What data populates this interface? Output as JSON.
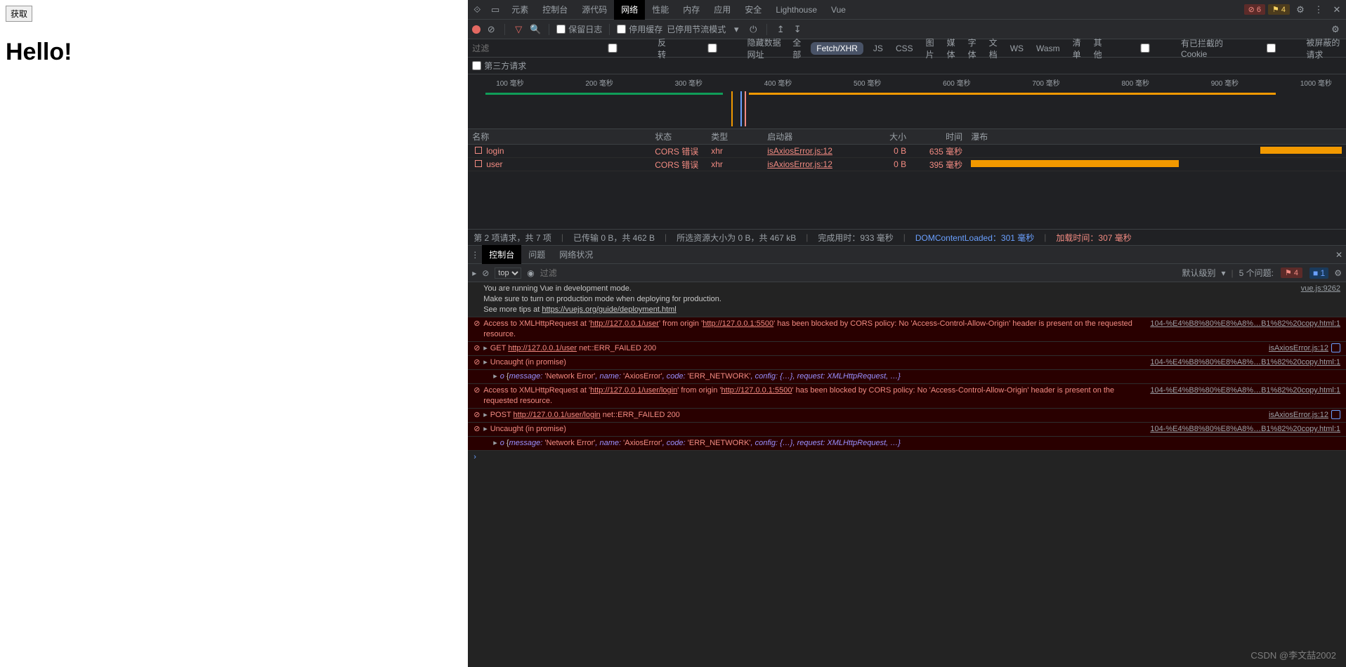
{
  "page": {
    "button": "获取",
    "heading": "Hello!"
  },
  "tabs": {
    "inspect": "",
    "device": "",
    "items": [
      "元素",
      "控制台",
      "源代码",
      "网络",
      "性能",
      "内存",
      "应用",
      "安全",
      "Lighthouse",
      "Vue"
    ],
    "active": "网络"
  },
  "topbadges": {
    "errors": "6",
    "warnings": "4"
  },
  "toolbar": {
    "preserve": "保留日志",
    "disablecache": "停用缓存",
    "throttling": "已停用节流模式"
  },
  "filter": {
    "placeholder": "过滤",
    "invert": "反转",
    "hidedata": "隐藏数据网址",
    "types": [
      "全部",
      "Fetch/XHR",
      "JS",
      "CSS",
      "图片",
      "媒体",
      "字体",
      "文档",
      "WS",
      "Wasm",
      "清单",
      "其他"
    ],
    "active": "Fetch/XHR",
    "blockedcookies": "有已拦截的 Cookie",
    "blockedreq": "被屏蔽的请求",
    "thirdparty": "第三方请求"
  },
  "timeline": {
    "ticks": [
      "100 毫秒",
      "200 毫秒",
      "300 毫秒",
      "400 毫秒",
      "500 毫秒",
      "600 毫秒",
      "700 毫秒",
      "800 毫秒",
      "900 毫秒",
      "1000 毫秒"
    ]
  },
  "net": {
    "headers": {
      "name": "名称",
      "status": "状态",
      "type": "类型",
      "initiator": "启动器",
      "size": "大小",
      "time": "时间",
      "waterfall": "瀑布"
    },
    "rows": [
      {
        "name": "login",
        "status": "CORS 错误",
        "type": "xhr",
        "initiator": "isAxiosError.js:12",
        "size": "0 B",
        "time": "635 毫秒",
        "wfStart": 78,
        "wfLen": 22
      },
      {
        "name": "user",
        "status": "CORS 错误",
        "type": "xhr",
        "initiator": "isAxiosError.js:12",
        "size": "0 B",
        "time": "395 毫秒",
        "wfStart": 0,
        "wfLen": 56
      }
    ],
    "summary": {
      "requests": "第 2 项请求，共 7 项",
      "transferred": "已传输 0 B，共 462 B",
      "resources": "所选资源大小为 0 B，共 467 kB",
      "finish": "完成用时：933 毫秒",
      "dcl": "DOMContentLoaded：301 毫秒",
      "load": "加载时间：307 毫秒"
    }
  },
  "drawer": {
    "tabs": [
      "控制台",
      "问题",
      "网络状况"
    ],
    "active": "控制台",
    "ctx": "top",
    "filterPh": "过滤",
    "level": "默认级别",
    "issues": "5 个问题:",
    "ierr": "4",
    "iwarn": "1"
  },
  "console": {
    "info1": "You are running Vue in development mode.\nMake sure to turn on production mode when deploying for production.\nSee more tips at ",
    "info1link": "https://vuejs.org/guide/deployment.html",
    "info1src": "vue.js:9262",
    "err1a": "Access to XMLHttpRequest at '",
    "err1url": "http://127.0.0.1/user",
    "err1b": "' from origin '",
    "err1orig": "http://127.0.0.1:5500",
    "err1c": "' has been blocked by CORS policy: No 'Access-Control-Allow-Origin' header is present on the requested resource.",
    "err1src": "104-%E4%B8%80%E8%A8%…B1%82%20copy.html:1",
    "err2a": "GET ",
    "err2url": "http://127.0.0.1/user",
    "err2b": " net::ERR_FAILED 200",
    "err2src": "isAxiosError.js:12",
    "err3": "Uncaught (in promise)",
    "err3src": "104-%E4%B8%80%E8%A8%…B1%82%20copy.html:1",
    "obj": "o {message: 'Network Error', name: 'AxiosError', code: 'ERR_NETWORK', config: {…}, request: XMLHttpRequest, …}",
    "err4a": "Access to XMLHttpRequest at '",
    "err4url": "http://127.0.0.1/user/login",
    "err4b": "' from origin '",
    "err4orig": "http://127.0.0.1:5500",
    "err4c": "' has been blocked by CORS policy: No 'Access-Control-Allow-Origin' header is present on the requested resource.",
    "err4src": "104-%E4%B8%80%E8%A8%…B1%82%20copy.html:1",
    "err5a": "POST ",
    "err5url": "http://127.0.0.1/user/login",
    "err5b": " net::ERR_FAILED 200",
    "err5src": "isAxiosError.js:12"
  },
  "watermark": "CSDN @李文喆2002"
}
